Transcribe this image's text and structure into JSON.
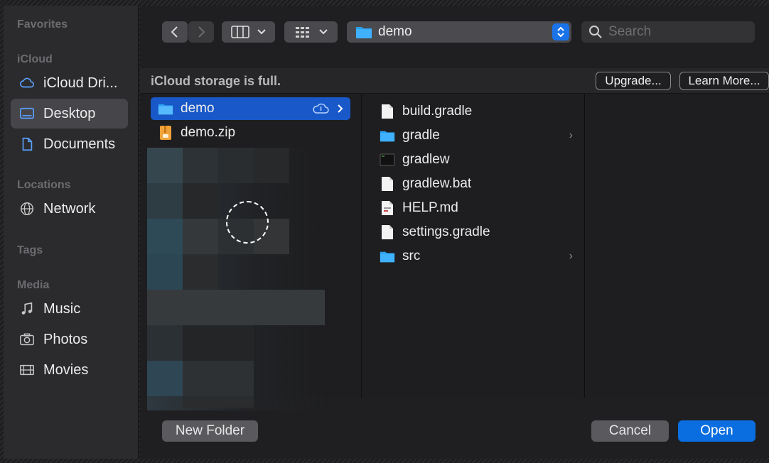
{
  "sidebar": {
    "favorites_heading": "Favorites",
    "icloud_heading": "iCloud",
    "locations_heading": "Locations",
    "tags_heading": "Tags",
    "media_heading": "Media",
    "items": {
      "icloud_drive": "iCloud Dri...",
      "desktop": "Desktop",
      "documents": "Documents",
      "network": "Network",
      "music": "Music",
      "photos": "Photos",
      "movies": "Movies"
    }
  },
  "toolbar": {
    "location_label": "demo",
    "search_placeholder": "Search"
  },
  "banner": {
    "message": "iCloud storage is full.",
    "upgrade_label": "Upgrade...",
    "learn_more_label": "Learn More..."
  },
  "column1": [
    {
      "name": "demo",
      "type": "folder",
      "selected": true
    },
    {
      "name": "demo.zip",
      "type": "archive",
      "selected": false
    }
  ],
  "column2": [
    {
      "name": "build.gradle",
      "type": "file"
    },
    {
      "name": "gradle",
      "type": "folder"
    },
    {
      "name": "gradlew",
      "type": "executable"
    },
    {
      "name": "gradlew.bat",
      "type": "file"
    },
    {
      "name": "HELP.md",
      "type": "markdown"
    },
    {
      "name": "settings.gradle",
      "type": "file"
    },
    {
      "name": "src",
      "type": "folder"
    }
  ],
  "footer": {
    "new_folder_label": "New Folder",
    "cancel_label": "Cancel",
    "open_label": "Open"
  },
  "colors": {
    "accent": "#1a73e8",
    "selection": "#1858c8",
    "open_button": "#0a6ee0"
  }
}
